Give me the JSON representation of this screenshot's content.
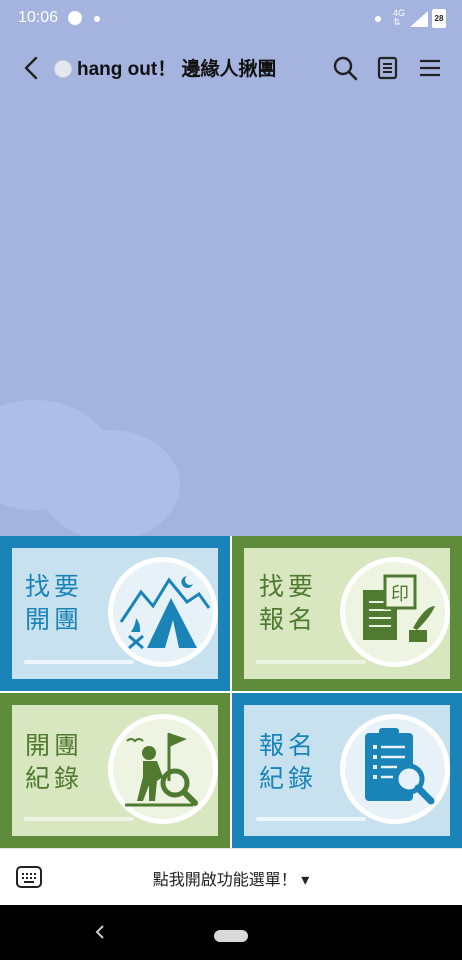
{
  "status_bar": {
    "time": "10:06",
    "network": "4G",
    "battery": "28"
  },
  "header": {
    "title": "hang out！ 邊緣人揪團"
  },
  "rich_menu": {
    "tiles": [
      {
        "line1": "找要",
        "line2": "開團"
      },
      {
        "line1": "找要",
        "line2": "報名"
      },
      {
        "line1": "開團",
        "line2": "紀錄"
      },
      {
        "line1": "報名",
        "line2": "紀錄"
      }
    ],
    "stamp_char": "印"
  },
  "bottom_bar": {
    "label": "點我開啟功能選單！ ▾"
  },
  "colors": {
    "blue": "#1a84b9",
    "green": "#5e8c3a",
    "chat_bg": "#a4b4df"
  }
}
